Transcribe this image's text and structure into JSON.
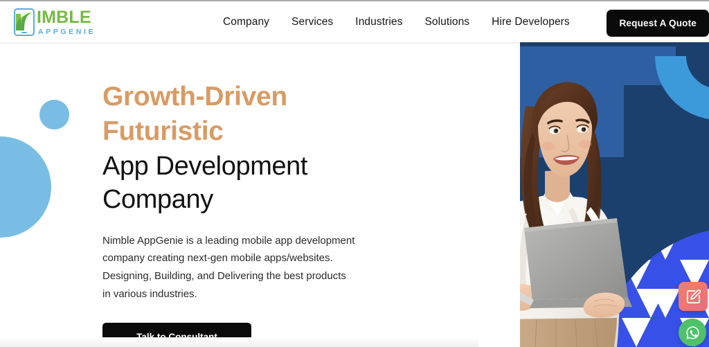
{
  "site": {
    "logo": {
      "mark_icon": "phone-outline-n-icon",
      "primary_text": "IMBLE",
      "secondary_text": "APPGENIE",
      "primary_color": "#76b944",
      "secondary_color": "#55acdf"
    }
  },
  "header": {
    "nav_items": [
      {
        "label": "Company"
      },
      {
        "label": "Services"
      },
      {
        "label": "Industries"
      },
      {
        "label": "Solutions"
      },
      {
        "label": "Hire Developers"
      }
    ],
    "cta": {
      "label": "Request A Quote",
      "background": "#0a0a0a",
      "text_color": "#ffffff"
    }
  },
  "hero": {
    "headline_accent_line1": "Growth-Driven",
    "headline_accent_line2": "Futuristic",
    "headline_main_line1": "App Development",
    "headline_main_line2": "Company",
    "accent_color": "#d89b64",
    "main_color": "#111111",
    "paragraph": "Nimble AppGenie is a leading mobile app development company creating next-gen mobile apps/websites. Designing, Building, and Delivering the best products in various industries.",
    "cta": {
      "label": "Talk to Consultant",
      "background": "#0a0a0a",
      "text_color": "#ffffff"
    },
    "decorations": {
      "circle_color": "#79bde4",
      "panel_navy": "#1c406e",
      "panel_blue": "#2e5fa3",
      "accent_blue": "#3d9ada",
      "triangle_blue": "#3750e8"
    },
    "image_alt": "smiling-woman-holding-laptop"
  },
  "floating_actions": [
    {
      "icon": "edit-pencil-icon",
      "name": "contact-form-button",
      "color": "#ee7570"
    },
    {
      "icon": "whatsapp-icon",
      "name": "whatsapp-button",
      "color": "#4ec16a"
    }
  ]
}
